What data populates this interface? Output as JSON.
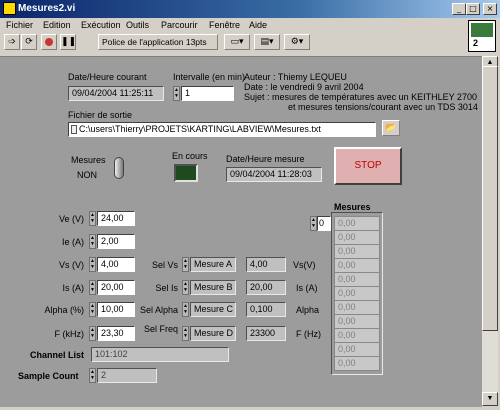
{
  "window": {
    "title": "Mesures2.vi",
    "min": "_",
    "max": "□",
    "close": "×"
  },
  "menu": [
    "Fichier",
    "Edition",
    "Exécution",
    "Outils",
    "Parcourir",
    "Fenêtre",
    "Aide"
  ],
  "toolbar": {
    "font": "Police de l'application 13pts"
  },
  "vi_icon_number": "2",
  "date_label": "Date/Heure courant",
  "date_value": "09/04/2004 11:25:11",
  "interval_label": "Intervalle (en min)",
  "interval_value": "1",
  "info": {
    "author": "Auteur : Thiemy LEQUEU",
    "date": "Date   : le vendredi 9 avril 2004",
    "sujet1": "Sujet   :  mesures de températures avec un KEITHLEY 2700",
    "sujet2": "et mesures tensions/courant avec un TDS 3014"
  },
  "file_label": "Fichier de sortie",
  "file_value": "C:\\users\\Thierry\\PROJETS\\KARTING\\LABVIEW\\Mesures.txt",
  "mesures_label": "Mesures",
  "mesures_state": "NON",
  "encours_label": "En cours",
  "datemesure_label": "Date/Heure mesure",
  "datemesure_value": "09/04/2004 11:28:03",
  "stop_label": "STOP",
  "rows": [
    {
      "label": "Ve (V)",
      "value": "24,00"
    },
    {
      "label": "Ie (A)",
      "value": "2,00"
    },
    {
      "label": "Vs (V)",
      "value": "4,00",
      "sel": "Sel Vs",
      "ring": "Mesure A",
      "out": "4,00",
      "unit": "Vs(V)"
    },
    {
      "label": "Is (A)",
      "value": "20,00",
      "sel": "Sel Is",
      "ring": "Mesure B",
      "out": "20,00",
      "unit": "Is (A)"
    },
    {
      "label": "Alpha (%)",
      "value": "10,00",
      "sel": "Sel Alpha",
      "ring": "Mesure C",
      "out": "0,100",
      "unit": "Alpha"
    },
    {
      "label": "F (kHz)",
      "value": "23,30",
      "sel": "Sel Freq",
      "ring": "Mesure D",
      "out": "23300",
      "unit": "F (Hz)"
    }
  ],
  "array_label": "Mesures",
  "array_index": "0",
  "array_values": [
    "0,00",
    "0,00",
    "0,00",
    "0,00",
    "0,00",
    "0,00",
    "0,00",
    "0,00",
    "0,00",
    "0,00",
    "0,00"
  ],
  "channel_label": "Channel List",
  "channel_value": "101:102",
  "sample_label": "Sample Count",
  "sample_value": "2"
}
